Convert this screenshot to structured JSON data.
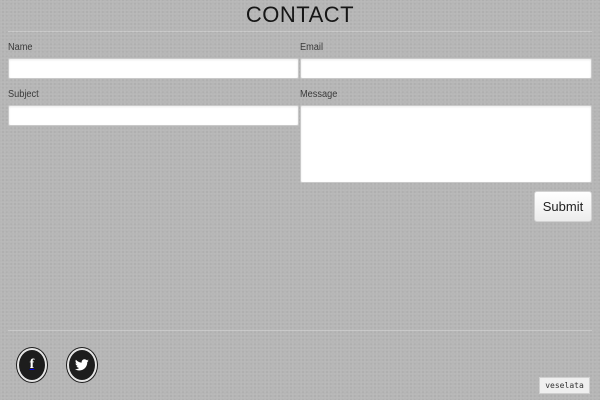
{
  "page": {
    "title": "CONTACT"
  },
  "form": {
    "name": {
      "label": "Name",
      "value": "",
      "placeholder": ""
    },
    "email": {
      "label": "Email",
      "value": "",
      "placeholder": ""
    },
    "subject": {
      "label": "Subject",
      "value": "",
      "placeholder": ""
    },
    "message": {
      "label": "Message",
      "value": "",
      "placeholder": ""
    },
    "submit_label": "Submit"
  },
  "footer": {
    "social": [
      {
        "name": "facebook",
        "icon": "facebook-icon",
        "glyph": "f"
      },
      {
        "name": "twitter",
        "icon": "twitter-bird-icon"
      }
    ],
    "credit": "veselata"
  },
  "colors": {
    "background": "#b6b6b6",
    "title": "#161616",
    "field": "#ffffff",
    "icon_circle": "#1d1d1d"
  }
}
